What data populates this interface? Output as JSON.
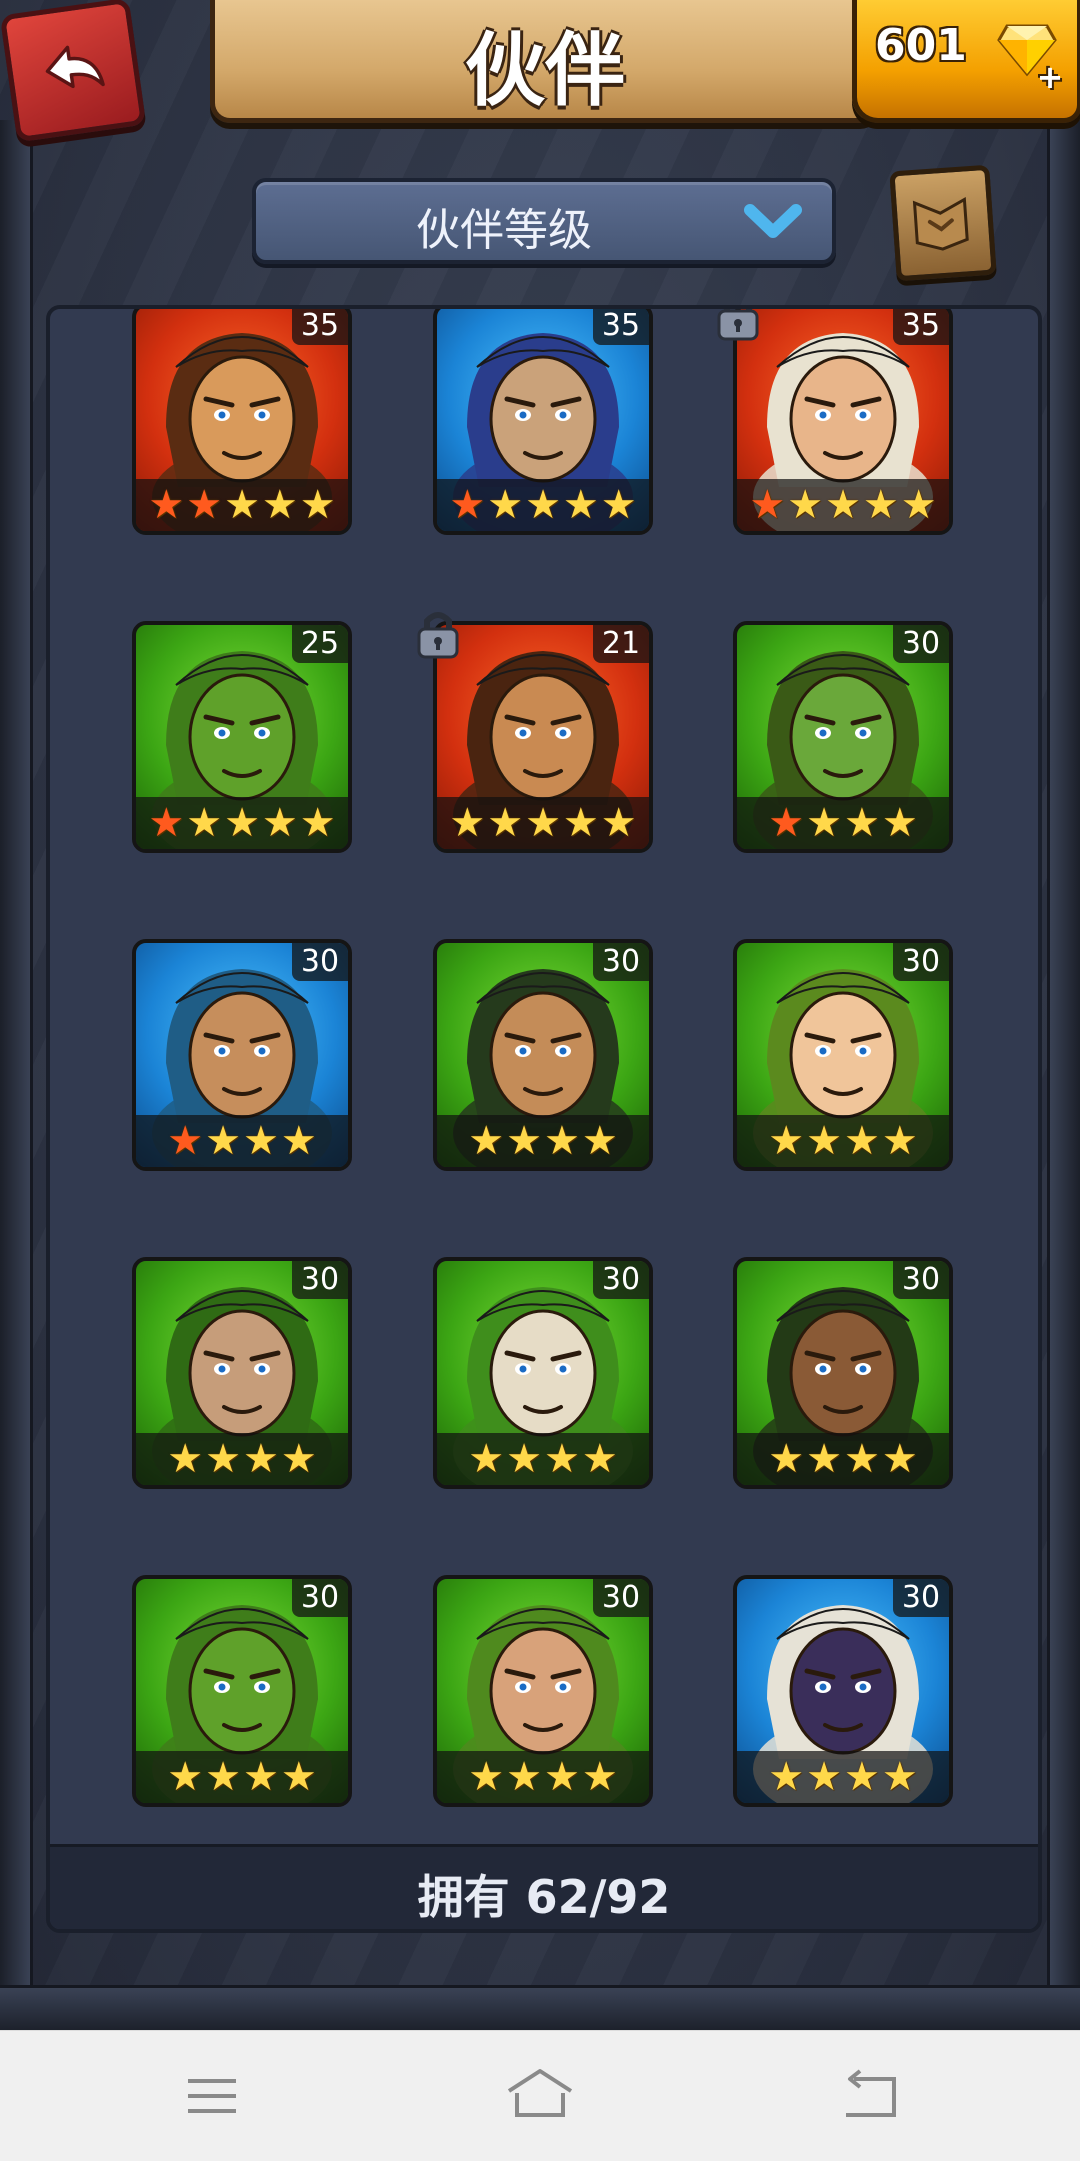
{
  "header": {
    "title": "伙伴",
    "gems": "601",
    "gem_plus": "+"
  },
  "filter": {
    "label": "伙伴等级"
  },
  "heroes": [
    {
      "level": "35",
      "bg": "red",
      "stars_total": 5,
      "stars_red": 2,
      "locked": false,
      "hair": "#5a2c12",
      "skin": "#d99a5b"
    },
    {
      "level": "35",
      "bg": "blue",
      "stars_total": 5,
      "stars_red": 1,
      "locked": false,
      "hair": "#2a3d8c",
      "skin": "#caa27a"
    },
    {
      "level": "35",
      "bg": "red",
      "stars_total": 5,
      "stars_red": 1,
      "locked": true,
      "hair": "#e8e2d0",
      "skin": "#e8b58a"
    },
    {
      "level": "25",
      "bg": "green",
      "stars_total": 5,
      "stars_red": 1,
      "locked": false,
      "hair": "#3f7d1a",
      "skin": "#5fa12a"
    },
    {
      "level": "21",
      "bg": "red",
      "stars_total": 5,
      "stars_red": 0,
      "locked": true,
      "hair": "#4a2410",
      "skin": "#c98a52"
    },
    {
      "level": "30",
      "bg": "green",
      "stars_total": 4,
      "stars_red": 1,
      "locked": false,
      "hair": "#3a5a16",
      "skin": "#6aa83a"
    },
    {
      "level": "30",
      "bg": "blue",
      "stars_total": 4,
      "stars_red": 1,
      "locked": false,
      "hair": "#1f5d86",
      "skin": "#c68e5c"
    },
    {
      "level": "30",
      "bg": "green",
      "stars_total": 4,
      "stars_red": 0,
      "locked": false,
      "hair": "#253a1c",
      "skin": "#c48c58"
    },
    {
      "level": "30",
      "bg": "green",
      "stars_total": 4,
      "stars_red": 0,
      "locked": false,
      "hair": "#5b8a1e",
      "skin": "#f0c59a"
    },
    {
      "level": "30",
      "bg": "green",
      "stars_total": 4,
      "stars_red": 0,
      "locked": false,
      "hair": "#2f6b14",
      "skin": "#c69d7a"
    },
    {
      "level": "30",
      "bg": "green",
      "stars_total": 4,
      "stars_red": 0,
      "locked": false,
      "hair": "#3f8e1c",
      "skin": "#e6dcc6"
    },
    {
      "level": "30",
      "bg": "green",
      "stars_total": 4,
      "stars_red": 0,
      "locked": false,
      "hair": "#233a16",
      "skin": "#8a5a36"
    },
    {
      "level": "30",
      "bg": "green",
      "stars_total": 4,
      "stars_red": 0,
      "locked": false,
      "hair": "#3f7d1a",
      "skin": "#5fa12a"
    },
    {
      "level": "30",
      "bg": "green",
      "stars_total": 4,
      "stars_red": 0,
      "locked": false,
      "hair": "#4f8a1e",
      "skin": "#d8a27a"
    },
    {
      "level": "30",
      "bg": "blue",
      "stars_total": 4,
      "stars_red": 0,
      "locked": false,
      "hair": "#e6e2d6",
      "skin": "#3a2e5a"
    }
  ],
  "footer": {
    "owned_text": "拥有 62/92"
  },
  "colors": {
    "accent_gold": "#ffcc33",
    "star_gold": "#ffd84a",
    "star_red": "#ff5a1e",
    "back_red": "#e0453c"
  }
}
